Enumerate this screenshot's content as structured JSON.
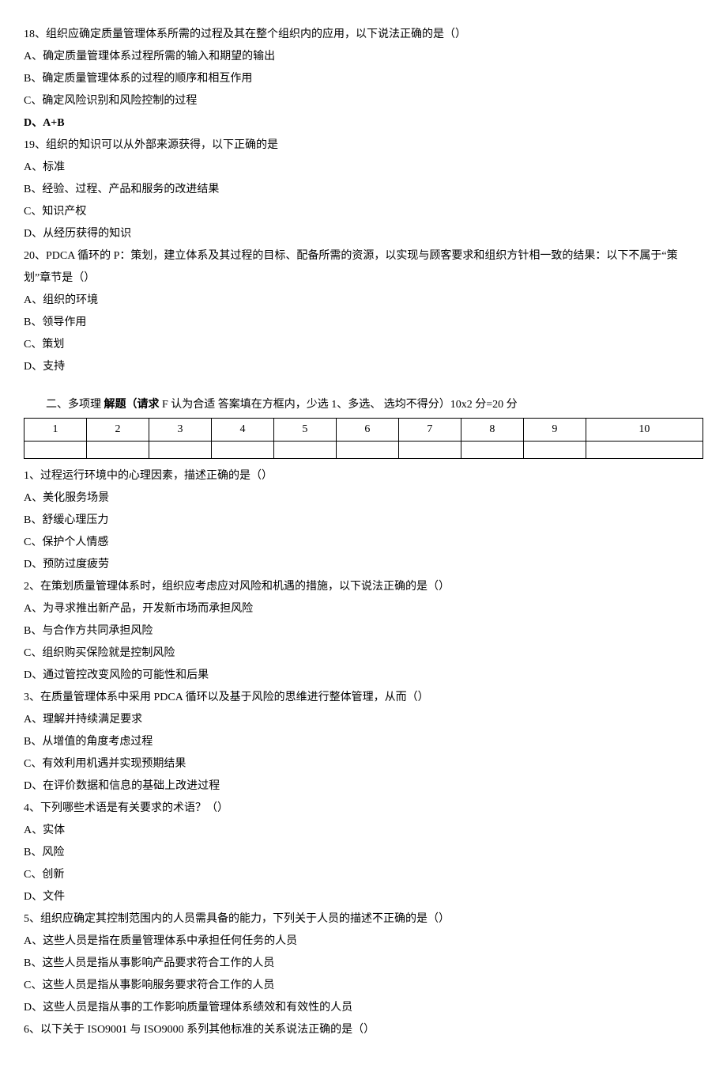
{
  "q18": {
    "text": "18、组织应确定质量管理体系所需的过程及其在整个组织内的应用，以下说法正确的是（）",
    "optA": "A、确定质量管理体系过程所需的输入和期望的输出",
    "optB": "B、确定质量管理体系的过程的顺序和相互作用",
    "optC": "C、确定风险识别和风险控制的过程",
    "optD": "D、A+B"
  },
  "q19": {
    "text": "19、组织的知识可以从外部来源获得，以下正确的是",
    "optA": "A、标准",
    "optB": "B、经验、过程、产品和服务的改进结果",
    "optC": "C、知识产权",
    "optD": "D、从经历获得的知识"
  },
  "q20": {
    "text": "20、PDCA 循环的 P：策划，建立体系及其过程的目标、配备所需的资源，以实现与顾客要求和组织方针相一致的结果：以下不属于“策划”章节是（）",
    "optA": "A、组织的环境",
    "optB": "B、领导作用",
    "optC": "C、策划",
    "optD": "D、支持"
  },
  "section2": {
    "prefix": "二、多项理 ",
    "boldPart": "解题（请求 ",
    "mid": "F 认为合适 答案填在方框内，少选  1、多选、 选均不得分）10x2 分=20 分"
  },
  "tableHeaders": [
    "1",
    "2",
    "3",
    "4",
    "5",
    "6",
    "7",
    "8",
    "9",
    "10"
  ],
  "mq1": {
    "text": "1、过程运行环境中的心理因素，描述正确的是（）",
    "optA": "A、美化服务场景",
    "optB": "B、舒缓心理压力",
    "optC": "C、保护个人情感",
    "optD": "D、预防过度疲劳"
  },
  "mq2": {
    "text": "2、在策划质量管理体系时，组织应考虑应对风险和机遇的措施，以下说法正确的是（）",
    "optA": "A、为寻求推出新产品，开发新市场而承担风险",
    "optB": "B、与合作方共同承担风险",
    "optC": "C、组织购买保险就是控制风险",
    "optD": "D、通过管控改变风险的可能性和后果"
  },
  "mq3": {
    "text": "3、在质量管理体系中采用 PDCA 循环以及基于风险的思维进行整体管理，从而（）",
    "optA": "A、理解并持续满足要求",
    "optB": "B、从增值的角度考虑过程",
    "optC": "C、有效利用机遇并实现预期结果",
    "optD": "D、在评价数据和信息的基础上改进过程"
  },
  "mq4": {
    "text": "4、下列哪些术语是有关要求的术语？（）",
    "optA": "A、实体",
    "optB": "B、风险",
    "optC": "C、创新",
    "optD": "D、文件"
  },
  "mq5": {
    "text": "5、组织应确定其控制范围内的人员需具备的能力，下列关于人员的描述不正确的是（）",
    "optA": "A、这些人员是指在质量管理体系中承担任何任务的人员",
    "optB": "B、这些人员是指从事影响产品要求符合工作的人员",
    "optC": "C、这些人员是指从事影响服务要求符合工作的人员",
    "optD": "D、这些人员是指从事的工作影响质量管理体系绩效和有效性的人员"
  },
  "mq6": {
    "text": "6、以下关于 ISO9001 与 ISO9000 系列其他标准的关系说法正确的是（）"
  }
}
